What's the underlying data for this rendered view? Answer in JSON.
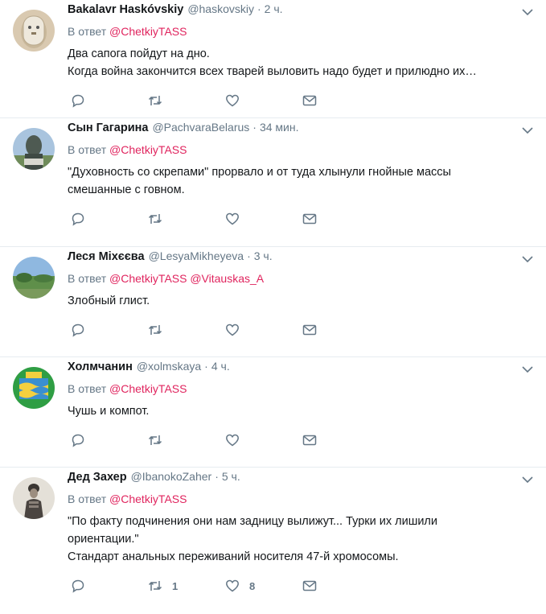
{
  "labels": {
    "reply_prefix": "В ответ"
  },
  "tweets": [
    {
      "name": "Bakalavr Haskóvskiy",
      "handle": "@haskovskiy",
      "sep": "·",
      "time": "2 ч.",
      "mentions": [
        "@ChetkiyTASS"
      ],
      "lines": [
        "Два сапога пойдут на дно.",
        "Когда война закончится всех тварей выловить надо будет и прилюдно их…"
      ],
      "retweets": "",
      "likes": ""
    },
    {
      "name": "Сын Гагарина",
      "handle": "@PachvaraBelarus",
      "sep": "·",
      "time": "34 мин.",
      "mentions": [
        "@ChetkiyTASS"
      ],
      "lines": [
        "\"Духовность со скрепами\" прорвало и от туда хлынули гнойные массы",
        "смешанные с говном."
      ],
      "retweets": "",
      "likes": ""
    },
    {
      "name": "Леся Міхєєва",
      "handle": "@LesyaMikheyeva",
      "sep": "·",
      "time": "3 ч.",
      "mentions": [
        "@ChetkiyTASS",
        "@Vitauskas_A"
      ],
      "lines": [
        "Злобный глист."
      ],
      "retweets": "",
      "likes": ""
    },
    {
      "name": "Холмчанин",
      "handle": "@xolmskaya",
      "sep": "·",
      "time": "4 ч.",
      "mentions": [
        "@ChetkiyTASS"
      ],
      "lines": [
        "Чушь и компот."
      ],
      "retweets": "",
      "likes": ""
    },
    {
      "name": "Дед Захер",
      "handle": "@IbanokoZaher",
      "sep": "·",
      "time": "5 ч.",
      "mentions": [
        "@ChetkiyTASS"
      ],
      "lines": [
        "\"По факту подчинения они нам задницу вылижут... Турки их лишили",
        "ориентации.\"",
        "Стандарт анальных переживаний носителя 47-й хромосомы."
      ],
      "retweets": "1",
      "likes": "8"
    }
  ],
  "colors": {
    "mention": "#e0245e",
    "muted": "#657786",
    "text": "#14171a",
    "divider": "#e6ecf0"
  },
  "icons": [
    "reply-icon",
    "retweet-icon",
    "like-icon",
    "message-icon",
    "chevron-down-icon"
  ]
}
